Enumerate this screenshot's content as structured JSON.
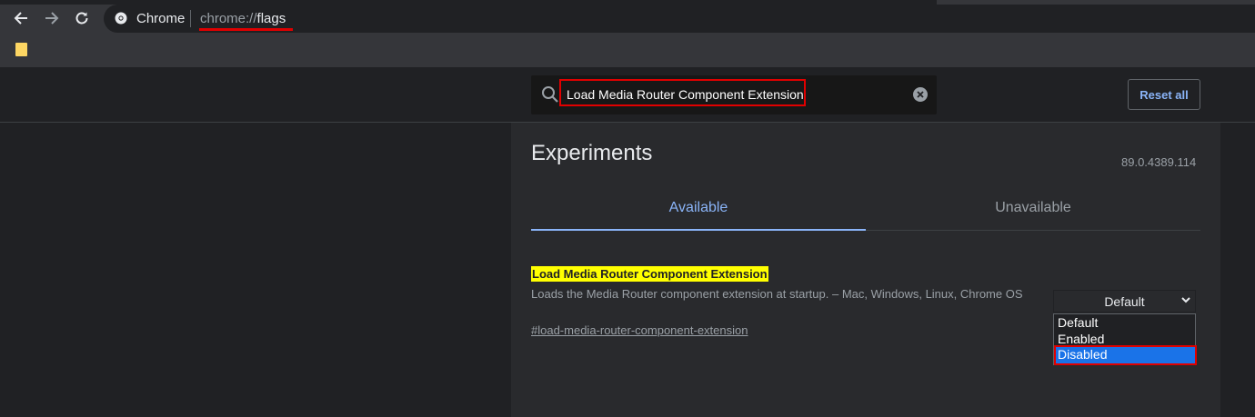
{
  "browser": {
    "site_label": "Chrome",
    "url_scheme": "chrome://",
    "url_path": "flags"
  },
  "header": {
    "search_value": "Load Media Router Component Extension",
    "reset_label": "Reset all"
  },
  "main": {
    "title": "Experiments",
    "version": "89.0.4389.114",
    "tabs": [
      {
        "label": "Available",
        "active": true
      },
      {
        "label": "Unavailable",
        "active": false
      }
    ]
  },
  "experiment": {
    "name": "Load Media Router Component Extension",
    "description": "Loads the Media Router component extension at startup. – Mac, Windows, Linux, Chrome OS",
    "link": "#load-media-router-component-extension",
    "selected": "Default",
    "options": [
      "Default",
      "Enabled",
      "Disabled"
    ],
    "highlighted_option": "Disabled"
  },
  "colors": {
    "accent": "#8ab4f8",
    "annotation": "#e00000",
    "search_highlight": "#ffff00",
    "selected_option": "#1a73e8"
  }
}
